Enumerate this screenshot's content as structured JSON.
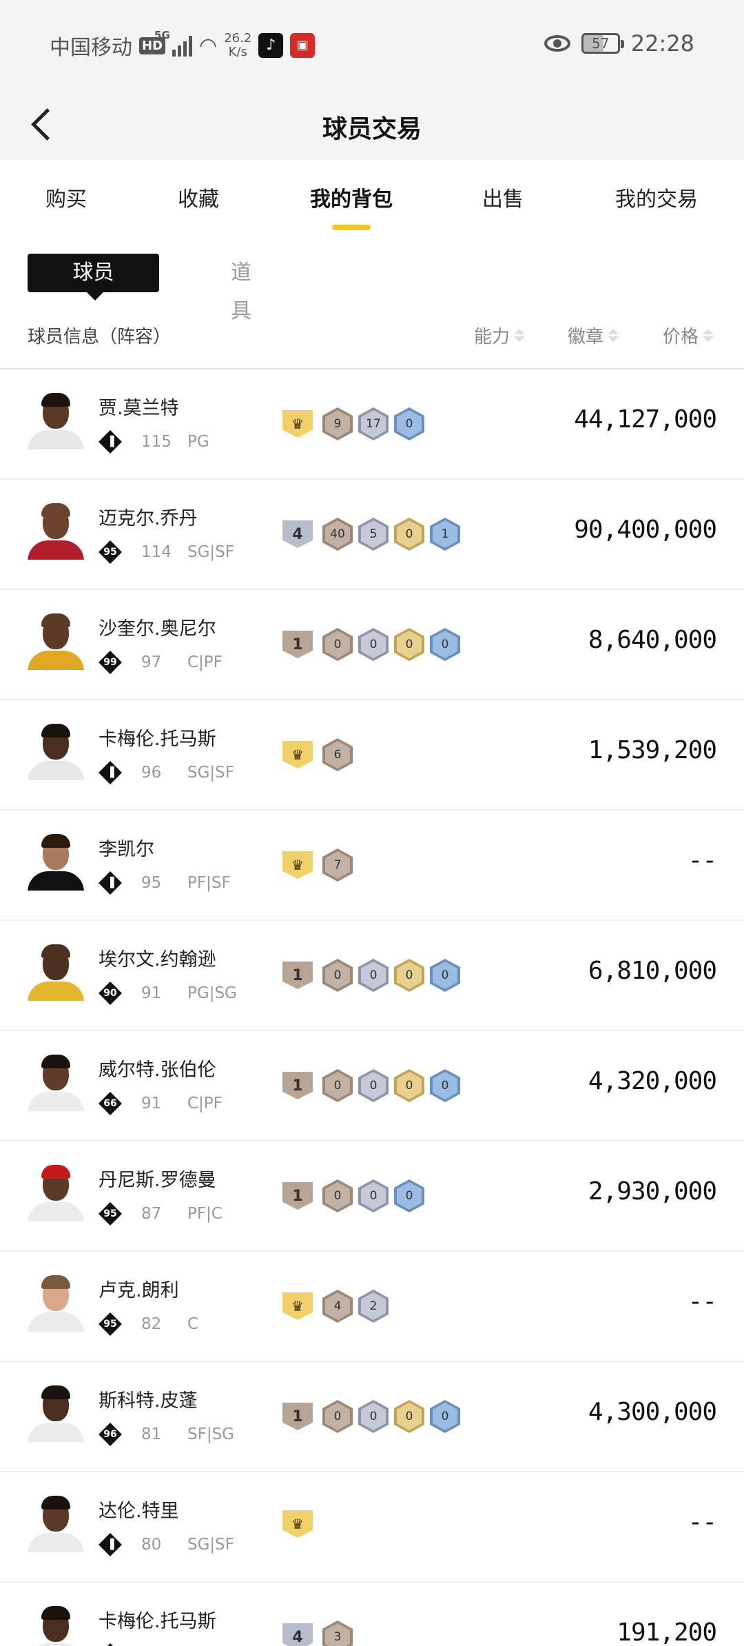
{
  "status": {
    "carrier": "中国移动",
    "hd": "HD",
    "net": "5G",
    "speed_top": "26.2",
    "speed_bottom": "K/s",
    "battery": "57",
    "time": "22:28"
  },
  "header": {
    "title": "球员交易"
  },
  "tabs": [
    {
      "label": "购买"
    },
    {
      "label": "收藏"
    },
    {
      "label": "我的背包"
    },
    {
      "label": "出售"
    },
    {
      "label": "我的交易"
    }
  ],
  "segment": {
    "active": "球员",
    "other": "道具"
  },
  "columns": {
    "info": "球员信息（阵容）",
    "ability": "能力",
    "badge": "徽章",
    "price": "价格"
  },
  "colors": {
    "accent": "#f5c518"
  },
  "players": [
    {
      "name": "贾.莫兰特",
      "tier": "",
      "ovr": "115",
      "pos": "PG",
      "shield": "crown",
      "badges": [
        [
          "bronze",
          "9"
        ],
        [
          "silver",
          "17"
        ],
        [
          "blue",
          "0"
        ]
      ],
      "price": "44,127,000",
      "skin": "#5a3a26",
      "hair": "#1a120c",
      "jersey": "#e8e8e8"
    },
    {
      "name": "迈克尔.乔丹",
      "tier": "95",
      "ovr": "114",
      "pos": "SG|SF",
      "shield": "4",
      "badges": [
        [
          "bronze",
          "40"
        ],
        [
          "silver",
          "5"
        ],
        [
          "gold",
          "0"
        ],
        [
          "blue",
          "1"
        ]
      ],
      "price": "90,400,000",
      "skin": "#6b4330",
      "hair": "#6b4330",
      "jersey": "#b0202c"
    },
    {
      "name": "沙奎尔.奥尼尔",
      "tier": "99",
      "ovr": "97",
      "pos": "C|PF",
      "shield": "1",
      "badges": [
        [
          "bronze",
          "0"
        ],
        [
          "silver",
          "0"
        ],
        [
          "gold",
          "0"
        ],
        [
          "blue",
          "0"
        ]
      ],
      "price": "8,640,000",
      "skin": "#5b3a28",
      "hair": "#5b3a28",
      "jersey": "#e3a726"
    },
    {
      "name": "卡梅伦.托马斯",
      "tier": "",
      "ovr": "96",
      "pos": "SG|SF",
      "shield": "crown",
      "badges": [
        [
          "bronze",
          "6"
        ]
      ],
      "price": "1,539,200",
      "skin": "#4a2e1f",
      "hair": "#1a120c",
      "jersey": "#e8e8e8"
    },
    {
      "name": "李凯尔",
      "tier": "",
      "ovr": "95",
      "pos": "PF|SF",
      "shield": "crown",
      "badges": [
        [
          "bronze",
          "7"
        ]
      ],
      "price": "--",
      "skin": "#a8795a",
      "hair": "#2a1a10",
      "jersey": "#111111"
    },
    {
      "name": "埃尔文.约翰逊",
      "tier": "90",
      "ovr": "91",
      "pos": "PG|SG",
      "shield": "1",
      "badges": [
        [
          "bronze",
          "0"
        ],
        [
          "silver",
          "0"
        ],
        [
          "gold",
          "0"
        ],
        [
          "blue",
          "0"
        ]
      ],
      "price": "6,810,000",
      "skin": "#4d3020",
      "hair": "#4d3020",
      "jersey": "#e3b52a"
    },
    {
      "name": "威尔特.张伯伦",
      "tier": "66",
      "ovr": "91",
      "pos": "C|PF",
      "shield": "1",
      "badges": [
        [
          "bronze",
          "0"
        ],
        [
          "silver",
          "0"
        ],
        [
          "gold",
          "0"
        ],
        [
          "blue",
          "0"
        ]
      ],
      "price": "4,320,000",
      "skin": "#5e3c2a",
      "hair": "#1a120c",
      "jersey": "#ececec"
    },
    {
      "name": "丹尼斯.罗德曼",
      "tier": "95",
      "ovr": "87",
      "pos": "PF|C",
      "shield": "1",
      "badges": [
        [
          "bronze",
          "0"
        ],
        [
          "silver",
          "0"
        ],
        [
          "blue",
          "0"
        ]
      ],
      "price": "2,930,000",
      "skin": "#5a3a28",
      "hair": "#c41a1a",
      "jersey": "#ececec"
    },
    {
      "name": "卢克.朗利",
      "tier": "95",
      "ovr": "82",
      "pos": "C",
      "shield": "crown",
      "badges": [
        [
          "bronze",
          "4"
        ],
        [
          "silver",
          "2"
        ]
      ],
      "price": "--",
      "skin": "#d9a889",
      "hair": "#7a5a40",
      "jersey": "#ececec"
    },
    {
      "name": "斯科特.皮蓬",
      "tier": "96",
      "ovr": "81",
      "pos": "SF|SG",
      "shield": "1",
      "badges": [
        [
          "bronze",
          "0"
        ],
        [
          "silver",
          "0"
        ],
        [
          "gold",
          "0"
        ],
        [
          "blue",
          "0"
        ]
      ],
      "price": "4,300,000",
      "skin": "#4a2e1f",
      "hair": "#1a120c",
      "jersey": "#ececec"
    },
    {
      "name": "达伦.特里",
      "tier": "",
      "ovr": "80",
      "pos": "SG|SF",
      "shield": "crown",
      "badges": [],
      "price": "--",
      "skin": "#5b3a28",
      "hair": "#1a120c",
      "jersey": "#ececec"
    },
    {
      "name": "卡梅伦.托马斯",
      "tier": "",
      "ovr": "",
      "pos": "",
      "shield": "4",
      "badges": [
        [
          "bronze",
          "3"
        ]
      ],
      "price": "191,200",
      "skin": "#4a2e1f",
      "hair": "#1a120c",
      "jersey": "#ececec"
    }
  ]
}
